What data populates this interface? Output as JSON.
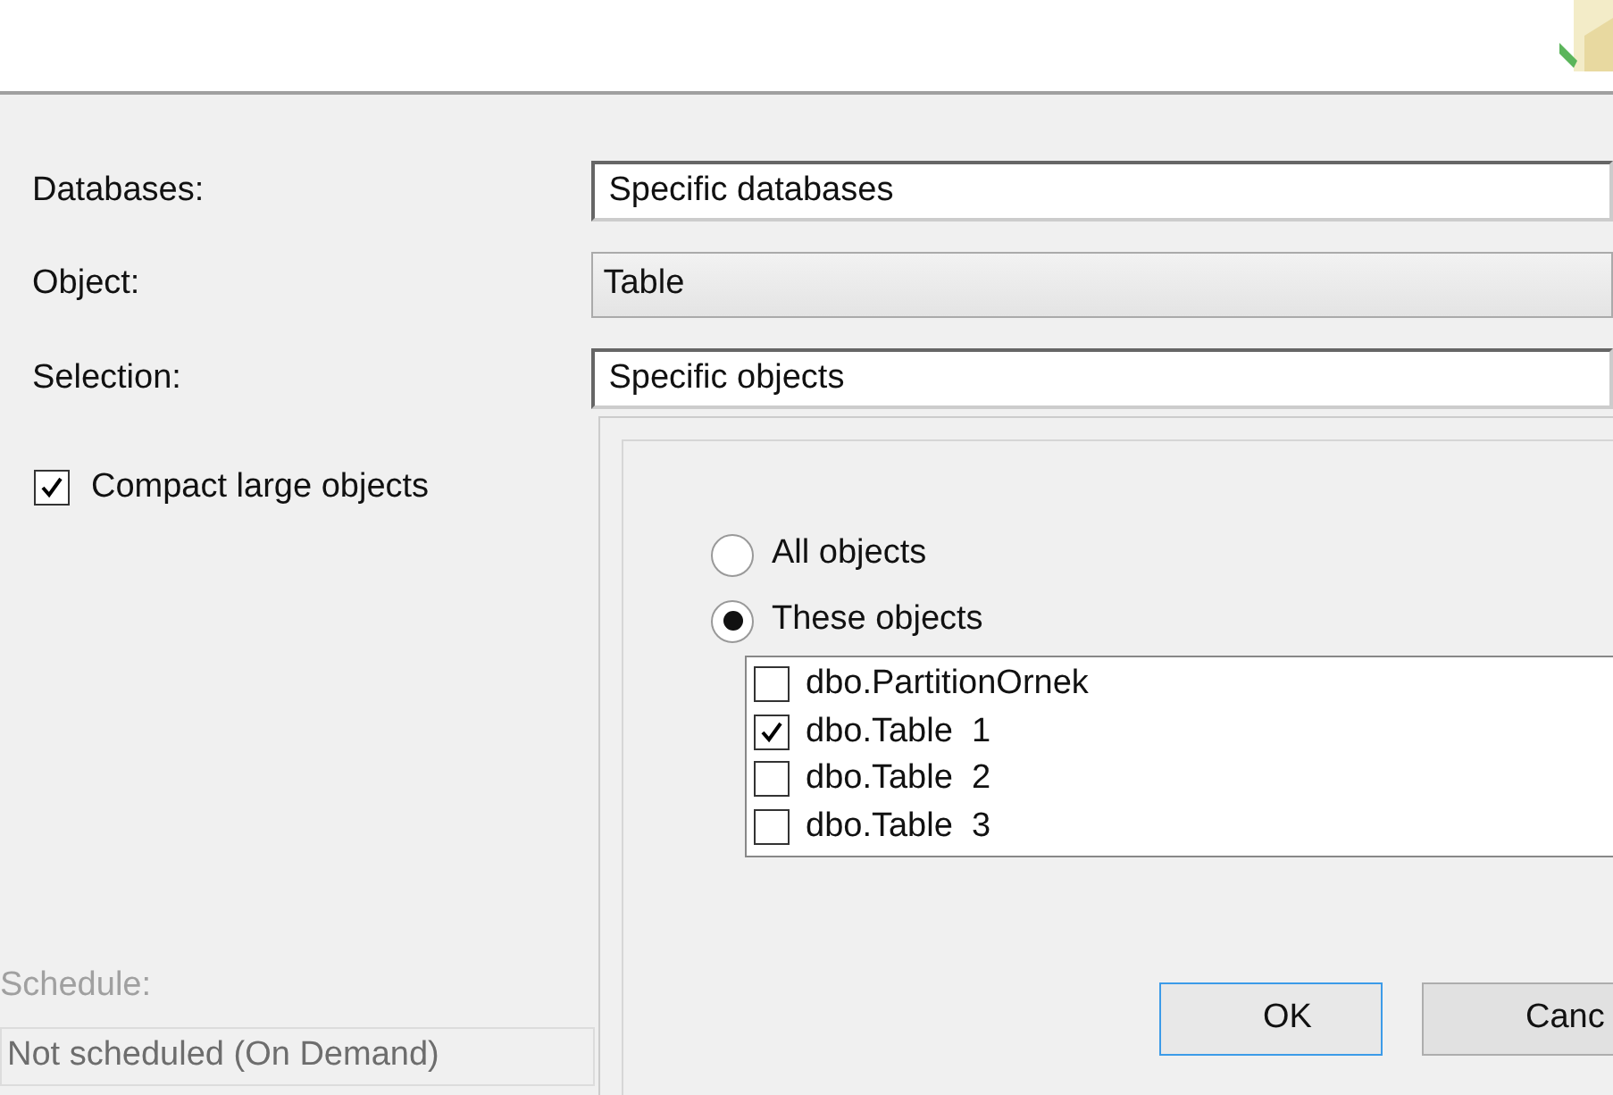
{
  "fields": [
    {
      "label": "Databases:",
      "value": "Specific databases",
      "kind": "combo"
    },
    {
      "label": "Object:",
      "value": "Table",
      "kind": "select"
    },
    {
      "label": "Selection:",
      "value": "Specific objects",
      "kind": "combo"
    }
  ],
  "compact": {
    "label": "Compact large objects",
    "checked": true
  },
  "schedule": {
    "label": "Schedule:",
    "value": "Not scheduled (On Demand)",
    "disabled": true
  },
  "popup": {
    "options": [
      {
        "label": "All objects",
        "selected": false
      },
      {
        "label": "These objects",
        "selected": true
      }
    ],
    "objects": [
      {
        "label": "dbo.PartitionOrnek",
        "checked": false
      },
      {
        "label": "dbo.Table  1",
        "checked": true
      },
      {
        "label": "dbo.Table  2",
        "checked": false
      },
      {
        "label": "dbo.Table  3",
        "checked": false
      }
    ],
    "buttons": [
      {
        "label": "OK",
        "kind": "default"
      },
      {
        "label": "Canc",
        "kind": "normal"
      }
    ]
  }
}
